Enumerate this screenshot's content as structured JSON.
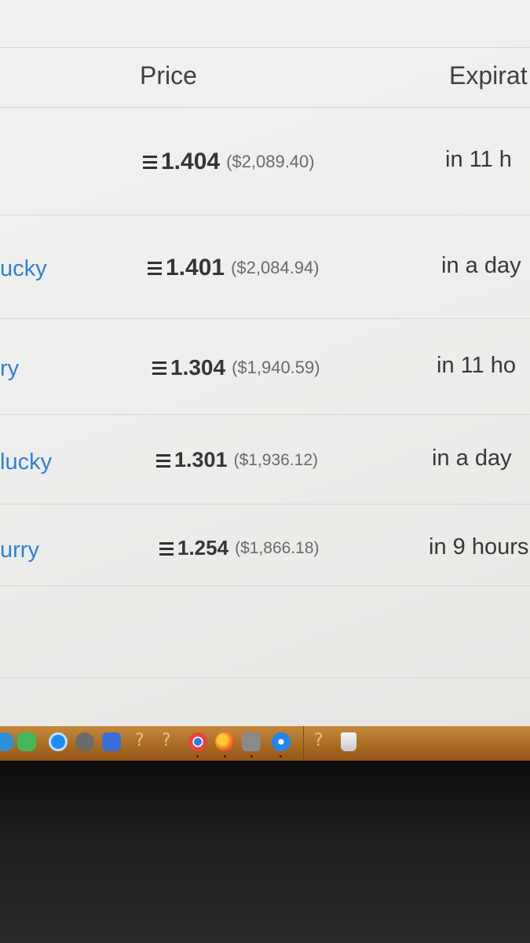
{
  "table": {
    "headers": {
      "price": "Price",
      "expiration": "Expirat"
    },
    "currency_symbol_icon": "ethereum-icon",
    "rows": [
      {
        "from": "",
        "eth": "1.404",
        "usd": "($2,089.40)",
        "expiration": "in 11 h"
      },
      {
        "from": "ucky",
        "eth": "1.401",
        "usd": "($2,084.94)",
        "expiration": "in a day"
      },
      {
        "from": "ry",
        "eth": "1.304",
        "usd": "($1,940.59)",
        "expiration": "in 11 ho"
      },
      {
        "from": "lucky",
        "eth": "1.301",
        "usd": "($1,936.12)",
        "expiration": "in a day"
      },
      {
        "from": "urry",
        "eth": "1.254",
        "usd": "($1,866.18)",
        "expiration": "in 9 hours"
      }
    ]
  },
  "dock": {
    "items": [
      "finder-icon",
      "messages-icon",
      "app-store-icon",
      "photo-icon",
      "system-icon",
      "question-icon",
      "question-icon",
      "chrome-icon",
      "firefox-icon",
      "calculator-icon",
      "safari-icon",
      "question-icon",
      "trash-icon"
    ]
  },
  "colors": {
    "link": "#2f7fd8",
    "dock": "#b0712a"
  }
}
